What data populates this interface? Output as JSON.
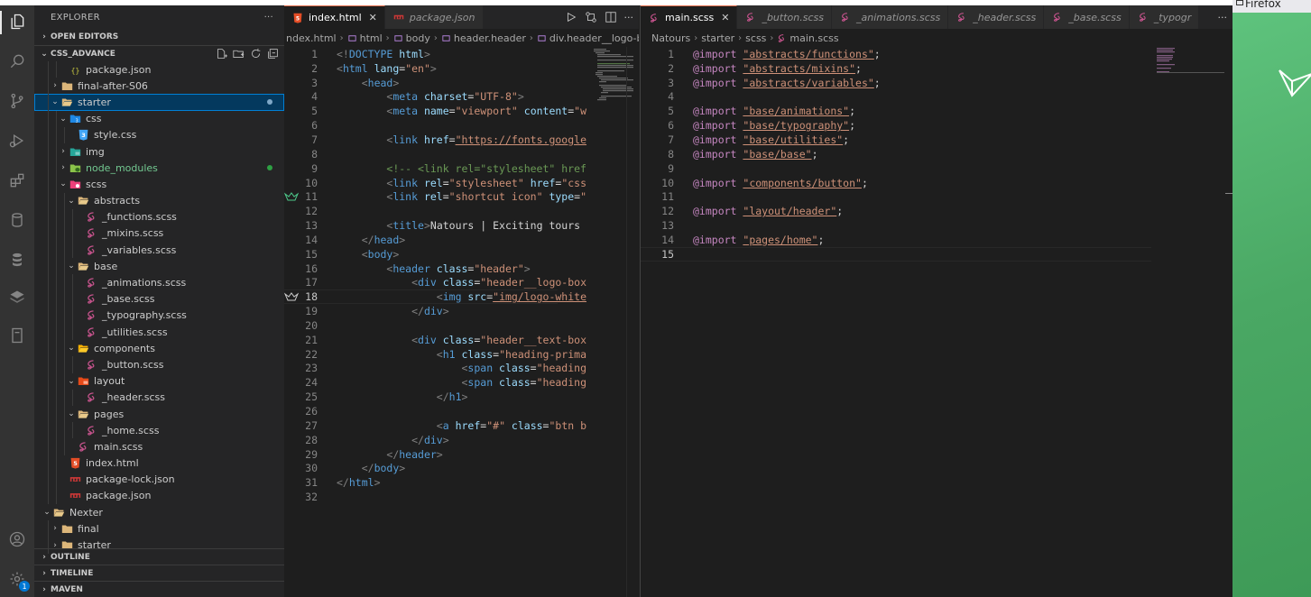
{
  "sidebar": {
    "title": "EXPLORER",
    "more": "···",
    "open_editors": "OPEN EDITORS",
    "workspace": "CSS_ADVANCE",
    "tree": [
      {
        "label": "package.json",
        "depth": 2,
        "icon": "json-icon",
        "chev": ""
      },
      {
        "label": "final-after-S06",
        "depth": 1,
        "icon": "folder-icon",
        "chev": "›"
      },
      {
        "label": "starter",
        "depth": 1,
        "icon": "folder-open-icon",
        "chev": "⌄",
        "selected": true,
        "dot": "#7fa8c8"
      },
      {
        "label": "css",
        "depth": 2,
        "icon": "css-folder-icon",
        "chev": "⌄"
      },
      {
        "label": "style.css",
        "depth": 3,
        "icon": "css-file-icon",
        "chev": ""
      },
      {
        "label": "img",
        "depth": 2,
        "icon": "img-folder-icon",
        "chev": "›"
      },
      {
        "label": "node_modules",
        "depth": 2,
        "icon": "node-folder-icon",
        "chev": "›",
        "green": true,
        "dot": "#2ea043"
      },
      {
        "label": "scss",
        "depth": 2,
        "icon": "sass-folder-icon",
        "chev": "⌄"
      },
      {
        "label": "abstracts",
        "depth": 3,
        "icon": "folder-open-icon",
        "chev": "⌄"
      },
      {
        "label": "_functions.scss",
        "depth": 4,
        "icon": "sass-icon",
        "chev": ""
      },
      {
        "label": "_mixins.scss",
        "depth": 4,
        "icon": "sass-icon",
        "chev": ""
      },
      {
        "label": "_variables.scss",
        "depth": 4,
        "icon": "sass-icon",
        "chev": ""
      },
      {
        "label": "base",
        "depth": 3,
        "icon": "folder-open-icon",
        "chev": "⌄"
      },
      {
        "label": "_animations.scss",
        "depth": 4,
        "icon": "sass-icon",
        "chev": ""
      },
      {
        "label": "_base.scss",
        "depth": 4,
        "icon": "sass-icon",
        "chev": ""
      },
      {
        "label": "_typography.scss",
        "depth": 4,
        "icon": "sass-icon",
        "chev": ""
      },
      {
        "label": "_utilities.scss",
        "depth": 4,
        "icon": "sass-icon",
        "chev": ""
      },
      {
        "label": "components",
        "depth": 3,
        "icon": "folder-components-icon",
        "chev": "⌄"
      },
      {
        "label": "_button.scss",
        "depth": 4,
        "icon": "sass-icon",
        "chev": ""
      },
      {
        "label": "layout",
        "depth": 3,
        "icon": "folder-layout-icon",
        "chev": "⌄"
      },
      {
        "label": "_header.scss",
        "depth": 4,
        "icon": "sass-icon",
        "chev": ""
      },
      {
        "label": "pages",
        "depth": 3,
        "icon": "folder-open-icon",
        "chev": "⌄"
      },
      {
        "label": "_home.scss",
        "depth": 4,
        "icon": "sass-icon",
        "chev": ""
      },
      {
        "label": "main.scss",
        "depth": 3,
        "icon": "sass-icon",
        "chev": ""
      },
      {
        "label": "index.html",
        "depth": 2,
        "icon": "html-icon",
        "chev": ""
      },
      {
        "label": "package-lock.json",
        "depth": 2,
        "icon": "npm-icon",
        "chev": ""
      },
      {
        "label": "package.json",
        "depth": 2,
        "icon": "npm-icon",
        "chev": ""
      },
      {
        "label": "Nexter",
        "depth": 0,
        "icon": "folder-open-icon",
        "chev": "⌄"
      },
      {
        "label": "final",
        "depth": 1,
        "icon": "folder-icon",
        "chev": "›"
      },
      {
        "label": "starter",
        "depth": 1,
        "icon": "folder-icon",
        "chev": "›"
      }
    ],
    "bottom": [
      "OUTLINE",
      "TIMELINE",
      "MAVEN"
    ]
  },
  "group1": {
    "tabs": [
      {
        "label": "index.html",
        "icon": "html-icon",
        "active": true,
        "close": "✕"
      },
      {
        "label": "package.json",
        "icon": "npm-icon",
        "active": false
      }
    ],
    "breadcrumb": [
      "ndex.html",
      "html",
      "body",
      "header.header",
      "div.header__logo-box"
    ],
    "lines": [
      [
        [
          "#808080",
          "<!"
        ],
        [
          "#569cd6",
          "DOCTYPE"
        ],
        [
          "#9cdcfe",
          " html"
        ],
        [
          "#808080",
          ">"
        ]
      ],
      [
        [
          "#808080",
          "<"
        ],
        [
          "#569cd6",
          "html"
        ],
        [
          "#9cdcfe",
          " lang"
        ],
        [
          "#d4d4d4",
          "="
        ],
        [
          "#ce9178",
          "\"en\""
        ],
        [
          "#808080",
          ">"
        ]
      ],
      [
        [
          "#d4d4d4",
          "    "
        ],
        [
          "#808080",
          "<"
        ],
        [
          "#569cd6",
          "head"
        ],
        [
          "#808080",
          ">"
        ]
      ],
      [
        [
          "#d4d4d4",
          "        "
        ],
        [
          "#808080",
          "<"
        ],
        [
          "#569cd6",
          "meta"
        ],
        [
          "#9cdcfe",
          " charset"
        ],
        [
          "#d4d4d4",
          "="
        ],
        [
          "#ce9178",
          "\"UTF-8\""
        ],
        [
          "#808080",
          ">"
        ]
      ],
      [
        [
          "#d4d4d4",
          "        "
        ],
        [
          "#808080",
          "<"
        ],
        [
          "#569cd6",
          "meta"
        ],
        [
          "#9cdcfe",
          " name"
        ],
        [
          "#d4d4d4",
          "="
        ],
        [
          "#ce9178",
          "\"viewport\""
        ],
        [
          "#9cdcfe",
          " content"
        ],
        [
          "#d4d4d4",
          "="
        ],
        [
          "#ce9178",
          "\"w"
        ]
      ],
      [],
      [
        [
          "#d4d4d4",
          "        "
        ],
        [
          "#808080",
          "<"
        ],
        [
          "#569cd6",
          "link"
        ],
        [
          "#9cdcfe",
          " href"
        ],
        [
          "#d4d4d4",
          "="
        ],
        [
          "#ce9178",
          "\"https://fonts.google"
        ]
      ],
      [],
      [
        [
          "#d4d4d4",
          "        "
        ],
        [
          "#6a9955",
          "<!-- <link rel=\"stylesheet\" href"
        ]
      ],
      [
        [
          "#d4d4d4",
          "        "
        ],
        [
          "#808080",
          "<"
        ],
        [
          "#569cd6",
          "link"
        ],
        [
          "#9cdcfe",
          " rel"
        ],
        [
          "#d4d4d4",
          "="
        ],
        [
          "#ce9178",
          "\"stylesheet\""
        ],
        [
          "#9cdcfe",
          " href"
        ],
        [
          "#d4d4d4",
          "="
        ],
        [
          "#ce9178",
          "\"css"
        ]
      ],
      [
        [
          "#d4d4d4",
          "        "
        ],
        [
          "#808080",
          "<"
        ],
        [
          "#569cd6",
          "link"
        ],
        [
          "#9cdcfe",
          " rel"
        ],
        [
          "#d4d4d4",
          "="
        ],
        [
          "#ce9178",
          "\"shortcut icon\""
        ],
        [
          "#9cdcfe",
          " type"
        ],
        [
          "#d4d4d4",
          "="
        ],
        [
          "#ce9178",
          "\""
        ]
      ],
      [],
      [
        [
          "#d4d4d4",
          "        "
        ],
        [
          "#808080",
          "<"
        ],
        [
          "#569cd6",
          "title"
        ],
        [
          "#808080",
          ">"
        ],
        [
          "#d4d4d4",
          "Natours | Exciting tours"
        ]
      ],
      [
        [
          "#d4d4d4",
          "    "
        ],
        [
          "#808080",
          "</"
        ],
        [
          "#569cd6",
          "head"
        ],
        [
          "#808080",
          ">"
        ]
      ],
      [
        [
          "#d4d4d4",
          "    "
        ],
        [
          "#808080",
          "<"
        ],
        [
          "#569cd6",
          "body"
        ],
        [
          "#808080",
          ">"
        ]
      ],
      [
        [
          "#d4d4d4",
          "        "
        ],
        [
          "#808080",
          "<"
        ],
        [
          "#569cd6",
          "header"
        ],
        [
          "#9cdcfe",
          " class"
        ],
        [
          "#d4d4d4",
          "="
        ],
        [
          "#ce9178",
          "\"header\""
        ],
        [
          "#808080",
          ">"
        ]
      ],
      [
        [
          "#d4d4d4",
          "            "
        ],
        [
          "#808080",
          "<"
        ],
        [
          "#569cd6",
          "div"
        ],
        [
          "#9cdcfe",
          " class"
        ],
        [
          "#d4d4d4",
          "="
        ],
        [
          "#ce9178",
          "\"header__logo-box"
        ]
      ],
      [
        [
          "#d4d4d4",
          "                "
        ],
        [
          "#808080",
          "<"
        ],
        [
          "#569cd6",
          "img"
        ],
        [
          "#9cdcfe",
          " src"
        ],
        [
          "#d4d4d4",
          "="
        ],
        [
          "#ce9178",
          "\"img/logo-white"
        ]
      ],
      [
        [
          "#d4d4d4",
          "            "
        ],
        [
          "#808080",
          "</"
        ],
        [
          "#569cd6",
          "div"
        ],
        [
          "#808080",
          ">"
        ]
      ],
      [],
      [
        [
          "#d4d4d4",
          "            "
        ],
        [
          "#808080",
          "<"
        ],
        [
          "#569cd6",
          "div"
        ],
        [
          "#9cdcfe",
          " class"
        ],
        [
          "#d4d4d4",
          "="
        ],
        [
          "#ce9178",
          "\"header__text-box"
        ]
      ],
      [
        [
          "#d4d4d4",
          "                "
        ],
        [
          "#808080",
          "<"
        ],
        [
          "#569cd6",
          "h1"
        ],
        [
          "#9cdcfe",
          " class"
        ],
        [
          "#d4d4d4",
          "="
        ],
        [
          "#ce9178",
          "\"heading-prima"
        ]
      ],
      [
        [
          "#d4d4d4",
          "                    "
        ],
        [
          "#808080",
          "<"
        ],
        [
          "#569cd6",
          "span"
        ],
        [
          "#9cdcfe",
          " class"
        ],
        [
          "#d4d4d4",
          "="
        ],
        [
          "#ce9178",
          "\"heading"
        ]
      ],
      [
        [
          "#d4d4d4",
          "                    "
        ],
        [
          "#808080",
          "<"
        ],
        [
          "#569cd6",
          "span"
        ],
        [
          "#9cdcfe",
          " class"
        ],
        [
          "#d4d4d4",
          "="
        ],
        [
          "#ce9178",
          "\"heading"
        ]
      ],
      [
        [
          "#d4d4d4",
          "                "
        ],
        [
          "#808080",
          "</"
        ],
        [
          "#569cd6",
          "h1"
        ],
        [
          "#808080",
          ">"
        ]
      ],
      [],
      [
        [
          "#d4d4d4",
          "                "
        ],
        [
          "#808080",
          "<"
        ],
        [
          "#569cd6",
          "a"
        ],
        [
          "#9cdcfe",
          " href"
        ],
        [
          "#d4d4d4",
          "="
        ],
        [
          "#ce9178",
          "\"#\""
        ],
        [
          "#9cdcfe",
          " class"
        ],
        [
          "#d4d4d4",
          "="
        ],
        [
          "#ce9178",
          "\"btn b"
        ]
      ],
      [
        [
          "#d4d4d4",
          "            "
        ],
        [
          "#808080",
          "</"
        ],
        [
          "#569cd6",
          "div"
        ],
        [
          "#808080",
          ">"
        ]
      ],
      [
        [
          "#d4d4d4",
          "        "
        ],
        [
          "#808080",
          "</"
        ],
        [
          "#569cd6",
          "header"
        ],
        [
          "#808080",
          ">"
        ]
      ],
      [
        [
          "#d4d4d4",
          "    "
        ],
        [
          "#808080",
          "</"
        ],
        [
          "#569cd6",
          "body"
        ],
        [
          "#808080",
          ">"
        ]
      ],
      [
        [
          "#808080",
          "</"
        ],
        [
          "#569cd6",
          "html"
        ],
        [
          "#808080",
          ">"
        ]
      ],
      []
    ],
    "current_line": 18
  },
  "group2": {
    "tabs": [
      {
        "label": "main.scss",
        "icon": "sass-icon",
        "active": true,
        "close": "✕"
      },
      {
        "label": "_button.scss",
        "icon": "sass-icon",
        "active": false
      },
      {
        "label": "_animations.scss",
        "icon": "sass-icon",
        "active": false
      },
      {
        "label": "_header.scss",
        "icon": "sass-icon",
        "active": false
      },
      {
        "label": "_base.scss",
        "icon": "sass-icon",
        "active": false
      },
      {
        "label": "_typogr",
        "icon": "sass-icon",
        "active": false
      }
    ],
    "more": "···",
    "breadcrumb": [
      "Natours",
      "starter",
      "scss",
      "main.scss"
    ],
    "lines": [
      [
        [
          "#c586c0",
          "@import "
        ],
        [
          "#ce9178",
          "\"abstracts/functions\""
        ],
        [
          "#d4d4d4",
          ";"
        ]
      ],
      [
        [
          "#c586c0",
          "@import "
        ],
        [
          "#ce9178",
          "\"abstracts/mixins\""
        ],
        [
          "#d4d4d4",
          ";"
        ]
      ],
      [
        [
          "#c586c0",
          "@import "
        ],
        [
          "#ce9178",
          "\"abstracts/variables\""
        ],
        [
          "#d4d4d4",
          ";"
        ]
      ],
      [],
      [
        [
          "#c586c0",
          "@import "
        ],
        [
          "#ce9178",
          "\"base/animations\""
        ],
        [
          "#d4d4d4",
          ";"
        ]
      ],
      [
        [
          "#c586c0",
          "@import "
        ],
        [
          "#ce9178",
          "\"base/typography\""
        ],
        [
          "#d4d4d4",
          ";"
        ]
      ],
      [
        [
          "#c586c0",
          "@import "
        ],
        [
          "#ce9178",
          "\"base/utilities\""
        ],
        [
          "#d4d4d4",
          ";"
        ]
      ],
      [
        [
          "#c586c0",
          "@import "
        ],
        [
          "#ce9178",
          "\"base/base\""
        ],
        [
          "#d4d4d4",
          ";"
        ]
      ],
      [],
      [
        [
          "#c586c0",
          "@import "
        ],
        [
          "#ce9178",
          "\"components/button\""
        ],
        [
          "#d4d4d4",
          ";"
        ]
      ],
      [],
      [
        [
          "#c586c0",
          "@import "
        ],
        [
          "#ce9178",
          "\"layout/header\""
        ],
        [
          "#d4d4d4",
          ";"
        ]
      ],
      [],
      [
        [
          "#c586c0",
          "@import "
        ],
        [
          "#ce9178",
          "\"pages/home\""
        ],
        [
          "#d4d4d4",
          ";"
        ]
      ],
      []
    ],
    "current_line": 15
  },
  "firefox": {
    "title": "Firefox"
  },
  "colors": {
    "accent": "#007fd4",
    "tab_border": "#e06c4b",
    "sass": "#c6538c",
    "html": "#e44d26",
    "npm": "#cb3837"
  }
}
